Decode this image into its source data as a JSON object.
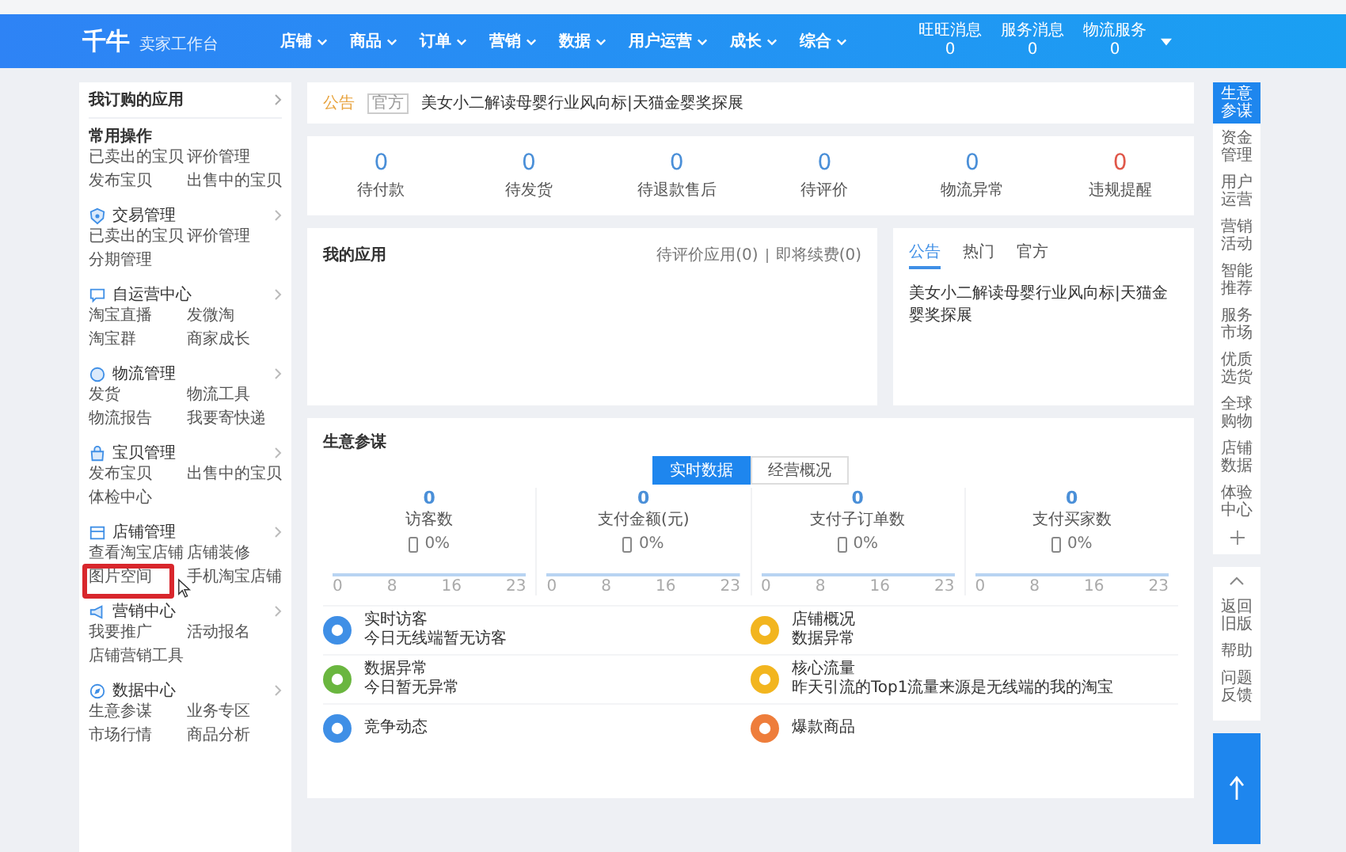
{
  "header": {
    "logo": "千牛",
    "subtitle": "卖家工作台",
    "nav": [
      {
        "label": "店铺"
      },
      {
        "label": "商品"
      },
      {
        "label": "订单"
      },
      {
        "label": "营销"
      },
      {
        "label": "数据"
      },
      {
        "label": "用户运营"
      },
      {
        "label": "成长"
      },
      {
        "label": "综合"
      }
    ],
    "counters": [
      {
        "label": "旺旺消息",
        "count": "0"
      },
      {
        "label": "服务消息",
        "count": "0"
      },
      {
        "label": "物流服务",
        "count": "0"
      }
    ]
  },
  "sidebar": {
    "title": "我订购的应用",
    "groups": [
      {
        "kind": "plain",
        "title": "常用操作",
        "links": [
          "已卖出的宝贝",
          "评价管理",
          "发布宝贝",
          "出售中的宝贝"
        ]
      },
      {
        "kind": "section",
        "title": "交易管理",
        "links": [
          "已卖出的宝贝",
          "评价管理",
          "分期管理"
        ]
      },
      {
        "kind": "section",
        "title": "自运营中心",
        "links": [
          "淘宝直播",
          "发微淘",
          "淘宝群",
          "商家成长"
        ]
      },
      {
        "kind": "section",
        "title": "物流管理",
        "links": [
          "发货",
          "物流工具",
          "物流报告",
          "我要寄快递"
        ]
      },
      {
        "kind": "section",
        "title": "宝贝管理",
        "links": [
          "发布宝贝",
          "出售中的宝贝",
          "体检中心"
        ]
      },
      {
        "kind": "section",
        "title": "店铺管理",
        "links": [
          "查看淘宝店铺",
          "店铺装修",
          "图片空间",
          "手机淘宝店铺"
        ]
      },
      {
        "kind": "section",
        "title": "营销中心",
        "links": [
          "我要推广",
          "活动报名",
          "店铺营销工具"
        ]
      },
      {
        "kind": "section",
        "title": "数据中心",
        "links": [
          "生意参谋",
          "业务专区",
          "市场行情",
          "商品分析"
        ]
      }
    ]
  },
  "notice": {
    "label": "公告",
    "tag": "官方",
    "text": "美女小二解读母婴行业风向标|天猫金婴奖探展"
  },
  "stats": [
    {
      "value": "0",
      "label": "待付款",
      "alert": false
    },
    {
      "value": "0",
      "label": "待发货",
      "alert": false
    },
    {
      "value": "0",
      "label": "待退款售后",
      "alert": false
    },
    {
      "value": "0",
      "label": "待评价",
      "alert": false
    },
    {
      "value": "0",
      "label": "物流异常",
      "alert": false
    },
    {
      "value": "0",
      "label": "违规提醒",
      "alert": true
    }
  ],
  "my_apps": {
    "title": "我的应用",
    "links": [
      "待评价应用(0)",
      "即将续费(0)"
    ]
  },
  "news": {
    "tabs": [
      {
        "label": "公告",
        "selected": true
      },
      {
        "label": "热门",
        "selected": false
      },
      {
        "label": "官方",
        "selected": false
      }
    ],
    "text": "美女小二解读母婴行业风向标|天猫金婴奖探展"
  },
  "business": {
    "title": "生意参谋",
    "toggle": [
      {
        "label": "实时数据",
        "selected": true
      },
      {
        "label": "经营概况",
        "selected": false
      }
    ],
    "metrics": [
      {
        "value": "0",
        "label": "访客数",
        "change": "0%",
        "ticks": [
          "0",
          "8",
          "16",
          "23"
        ]
      },
      {
        "value": "0",
        "label": "支付金额(元)",
        "change": "0%",
        "ticks": [
          "0",
          "8",
          "16",
          "23"
        ]
      },
      {
        "value": "0",
        "label": "支付子订单数",
        "change": "0%",
        "ticks": [
          "0",
          "8",
          "16",
          "23"
        ]
      },
      {
        "value": "0",
        "label": "支付买家数",
        "change": "0%",
        "ticks": [
          "0",
          "8",
          "16",
          "23"
        ]
      }
    ],
    "alerts": [
      {
        "title": "实时访客",
        "text": "今日无线端暂无访客",
        "color": "#3f8fe6"
      },
      {
        "title": "店铺概况",
        "text": "数据异常",
        "color": "#f2b51f"
      },
      {
        "title": "数据异常",
        "text": "今日暂无异常",
        "color": "#6ab63f"
      },
      {
        "title": "核心流量",
        "text": "昨天引流的Top1流量来源是无线端的我的淘宝",
        "color": "#f2b51f"
      },
      {
        "title": "竞争动态",
        "color": "#3f8fe6"
      },
      {
        "title": "爆款商品",
        "color": "#ee7d3b"
      }
    ]
  },
  "rail": {
    "items": [
      {
        "label": "生意参谋",
        "selected": true
      },
      {
        "label": "资金管理",
        "selected": false
      },
      {
        "label": "用户运营",
        "selected": false
      },
      {
        "label": "营销活动",
        "selected": false
      },
      {
        "label": "智能推荐",
        "selected": false
      },
      {
        "label": "服务市场",
        "selected": false
      },
      {
        "label": "优质选货",
        "selected": false
      },
      {
        "label": "全球购物",
        "selected": false
      },
      {
        "label": "店铺数据",
        "selected": false
      },
      {
        "label": "体验中心",
        "selected": false
      }
    ],
    "tools": [
      "返回旧版",
      "帮助",
      "问题反馈"
    ]
  }
}
